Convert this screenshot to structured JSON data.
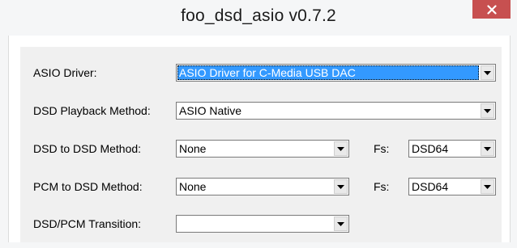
{
  "window": {
    "title": "foo_dsd_asio v0.7.2",
    "close_icon": "close-icon",
    "close_color": "#c75050"
  },
  "form": {
    "asio_driver": {
      "label": "ASIO Driver:",
      "value": "ASIO Driver for C-Media USB DAC"
    },
    "dsd_playback": {
      "label": "DSD Playback Method:",
      "value": "ASIO Native"
    },
    "dsd_to_dsd": {
      "label": "DSD to DSD Method:",
      "value": "None",
      "fs_label": "Fs:",
      "fs_value": "DSD64"
    },
    "pcm_to_dsd": {
      "label": "PCM to DSD Method:",
      "value": "None",
      "fs_label": "Fs:",
      "fs_value": "DSD64"
    },
    "transition": {
      "label": "DSD/PCM Transition:",
      "value": ""
    }
  },
  "colors": {
    "selection": "#3399ff",
    "panel": "#f0f0f0"
  }
}
